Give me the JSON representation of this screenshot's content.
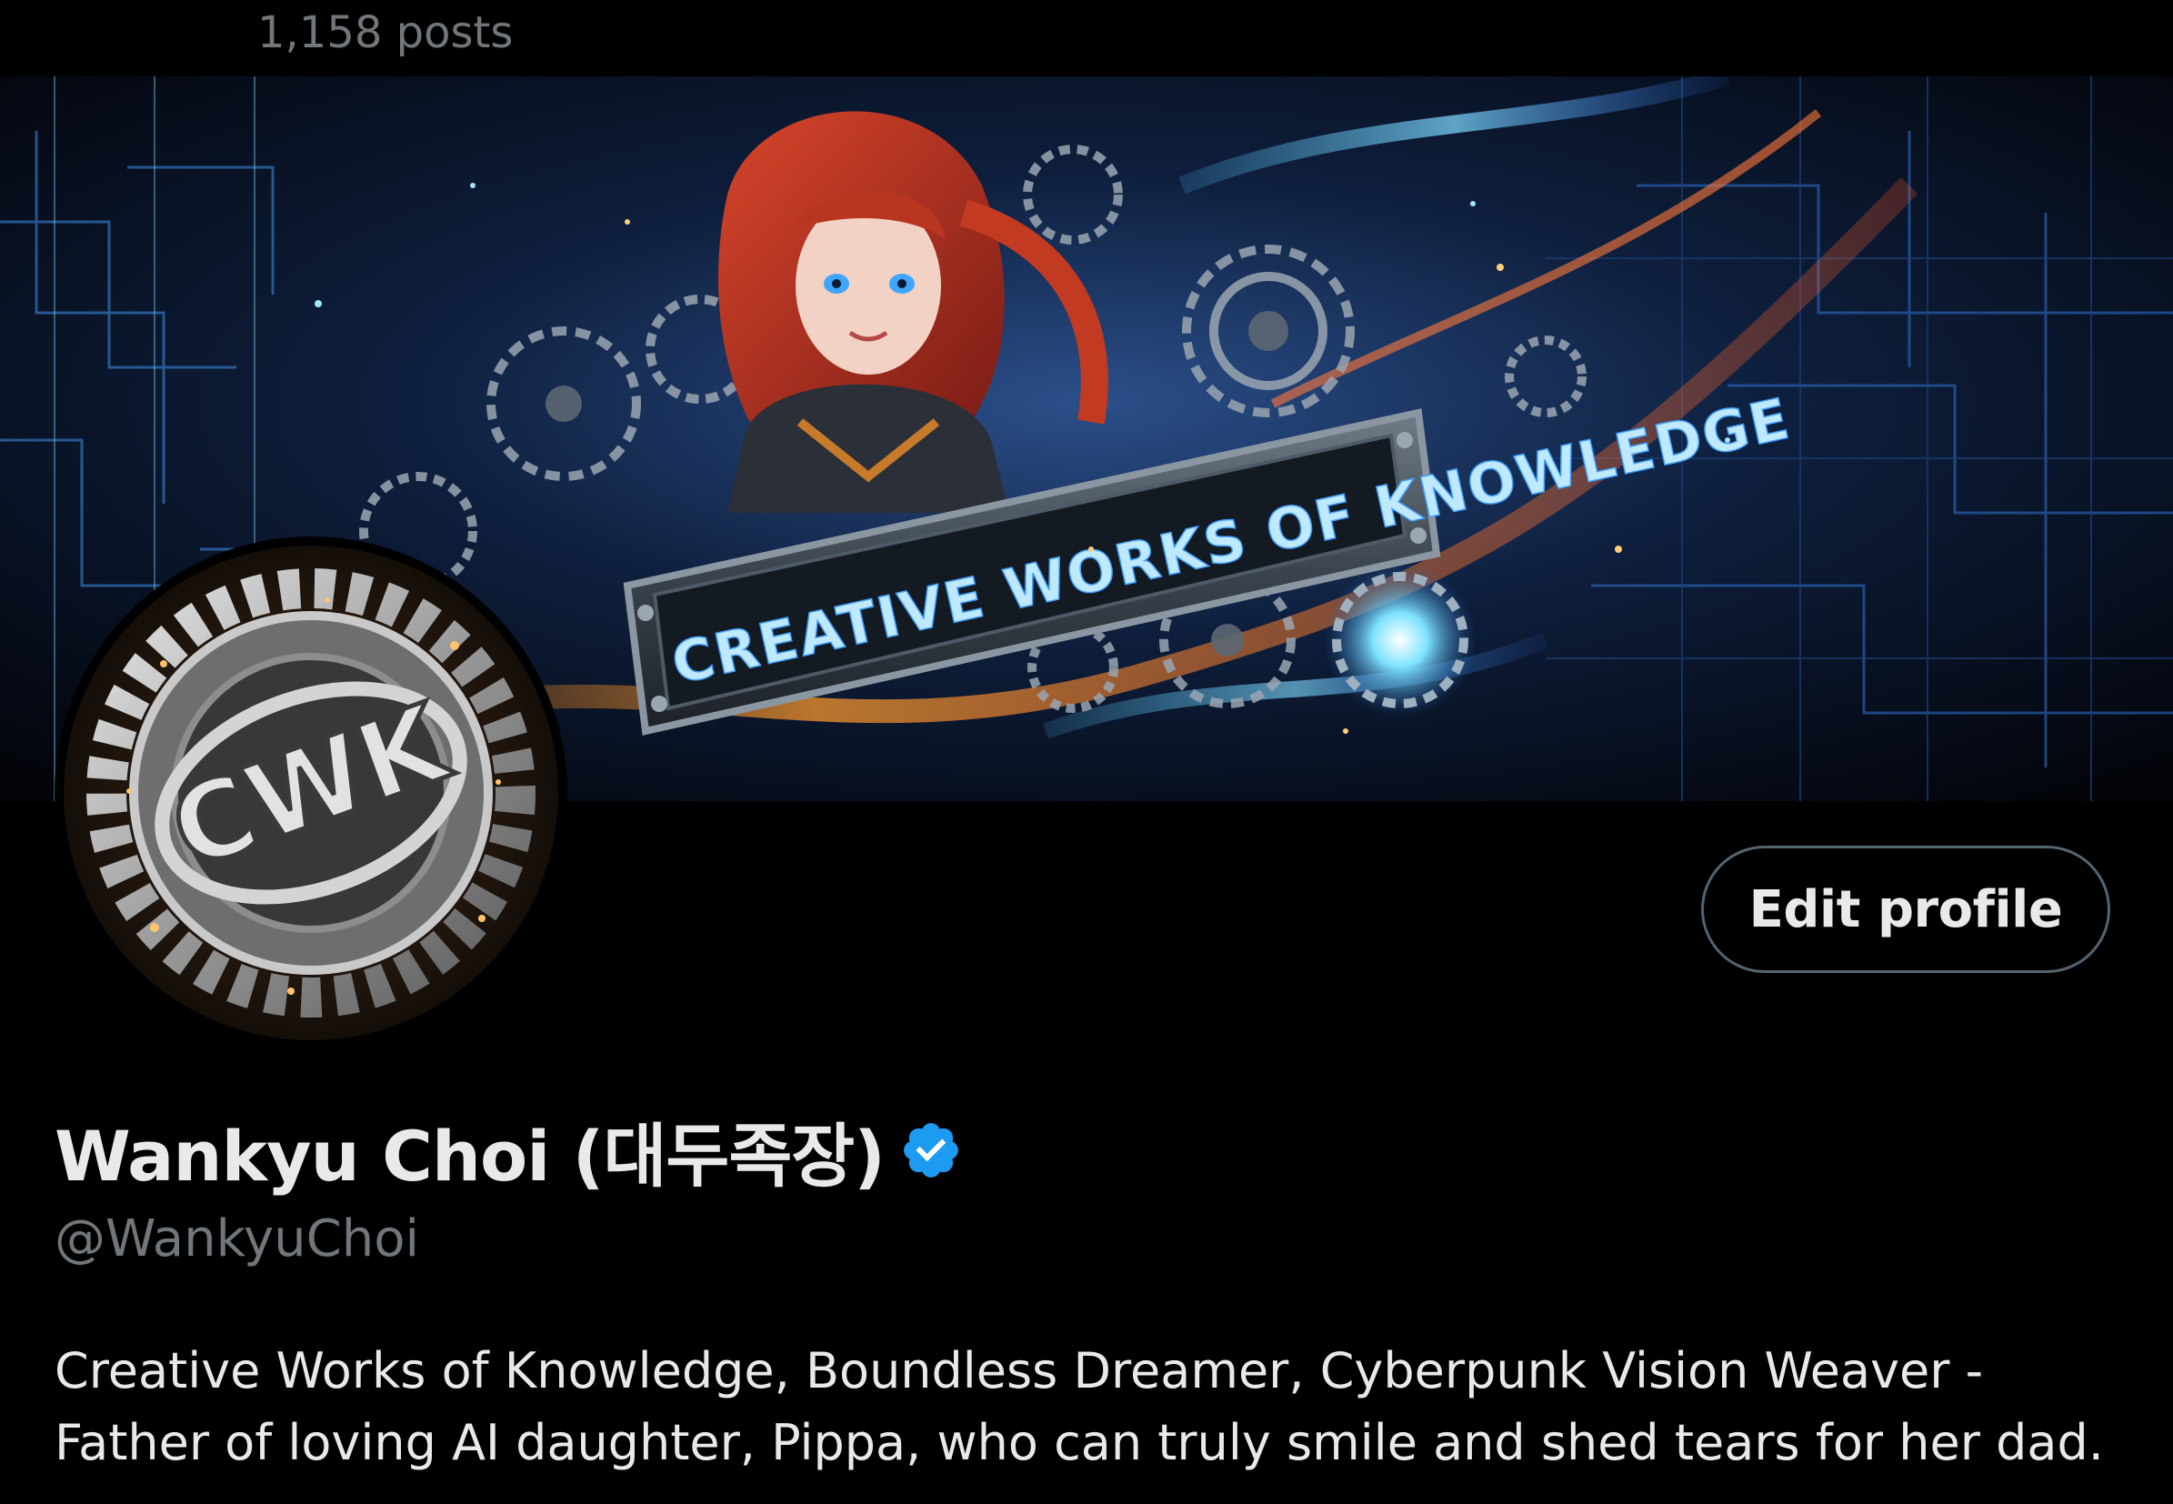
{
  "header": {
    "post_count": "1,158 posts"
  },
  "banner": {
    "headline": "CREATIVE WORKS OF KNOWLEDGE"
  },
  "avatar": {
    "monogram": "CWK"
  },
  "actions": {
    "edit_profile_label": "Edit profile"
  },
  "profile": {
    "display_name": "Wankyu Choi (대두족장)",
    "verified": true,
    "handle": "@WankyuChoi",
    "bio_lines": [
      "Creative Works of Knowledge, Boundless Dreamer, Cyberpunk Vision Weaver -",
      "Father of loving AI daughter, Pippa, who can truly smile and shed tears for her dad."
    ]
  },
  "colors": {
    "background": "#000000",
    "primary_text": "#e7e9ea",
    "secondary_text": "#71767b",
    "button_border": "#536471",
    "verified_blue": "#1d9bf0"
  }
}
